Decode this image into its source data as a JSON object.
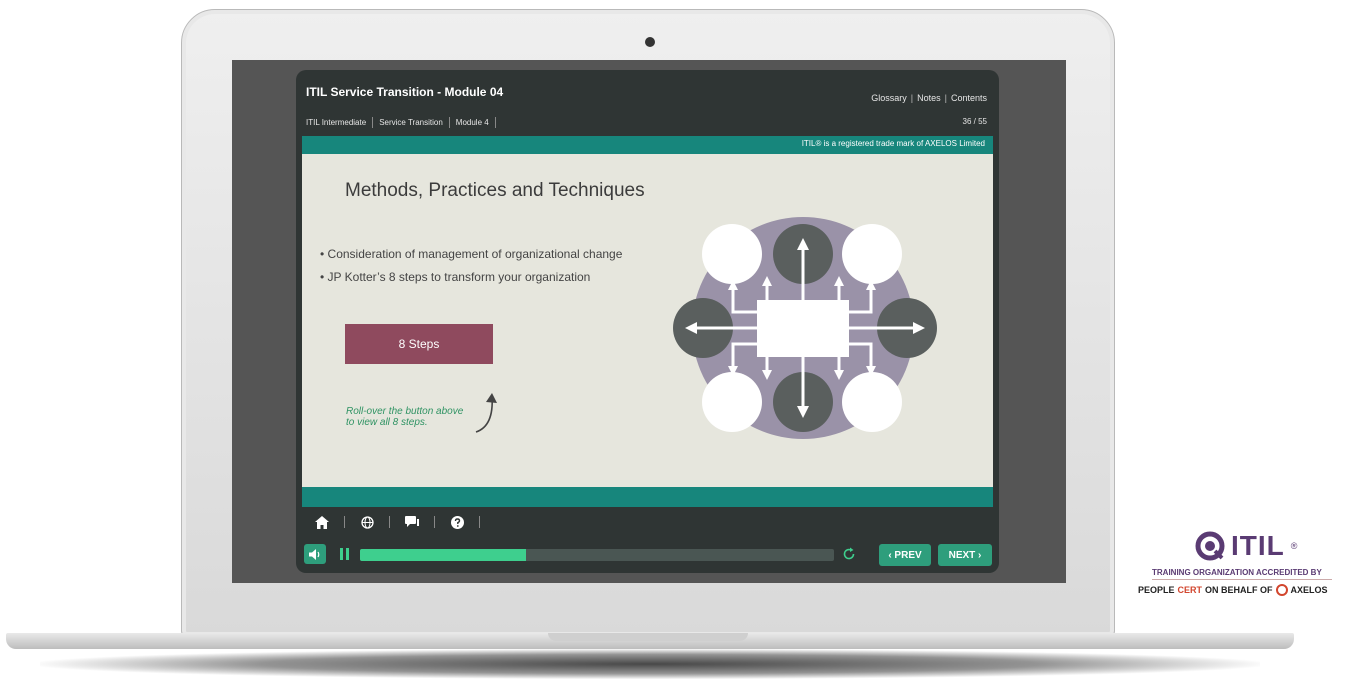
{
  "app": {
    "title": "ITIL Service Transition - Module 04",
    "links": [
      "Glossary",
      "Notes",
      "Contents"
    ],
    "link_separator": "|",
    "breadcrumbs": [
      "ITIL Intermediate",
      "Service Transition",
      "Module 4"
    ],
    "page_count": "36 / 55",
    "trademark": "ITIL® is a registered trade mark of AXELOS Limited"
  },
  "slide": {
    "title": "Methods, Practices and Techniques",
    "bullets": [
      "• Consideration of management of organizational change",
      "• JP Kotter’s 8 steps to transform your organization"
    ],
    "button_label": "8 Steps",
    "hint_line1": "Roll-over the button above",
    "hint_line2": "to view all 8 steps."
  },
  "toolbar": {
    "icons": [
      "home-icon",
      "globe-icon",
      "chat-icon",
      "help-icon"
    ]
  },
  "player": {
    "progress": 0.35,
    "prev_label": "‹ PREV",
    "next_label": "NEXT ›"
  },
  "logo": {
    "word": "ITIL",
    "registered": "®",
    "accredited": "TRAINING ORGANIZATION ACCREDITED BY",
    "people": "PEOPLE",
    "cert": "CERT",
    "on_behalf": "ON BEHALF OF",
    "axelos": "AXELOS"
  },
  "colors": {
    "teal": "#17867c",
    "green": "#2e9e7c",
    "button": "#8f4a5e",
    "hint": "#2f9363",
    "itil_purple": "#5a3b73"
  }
}
